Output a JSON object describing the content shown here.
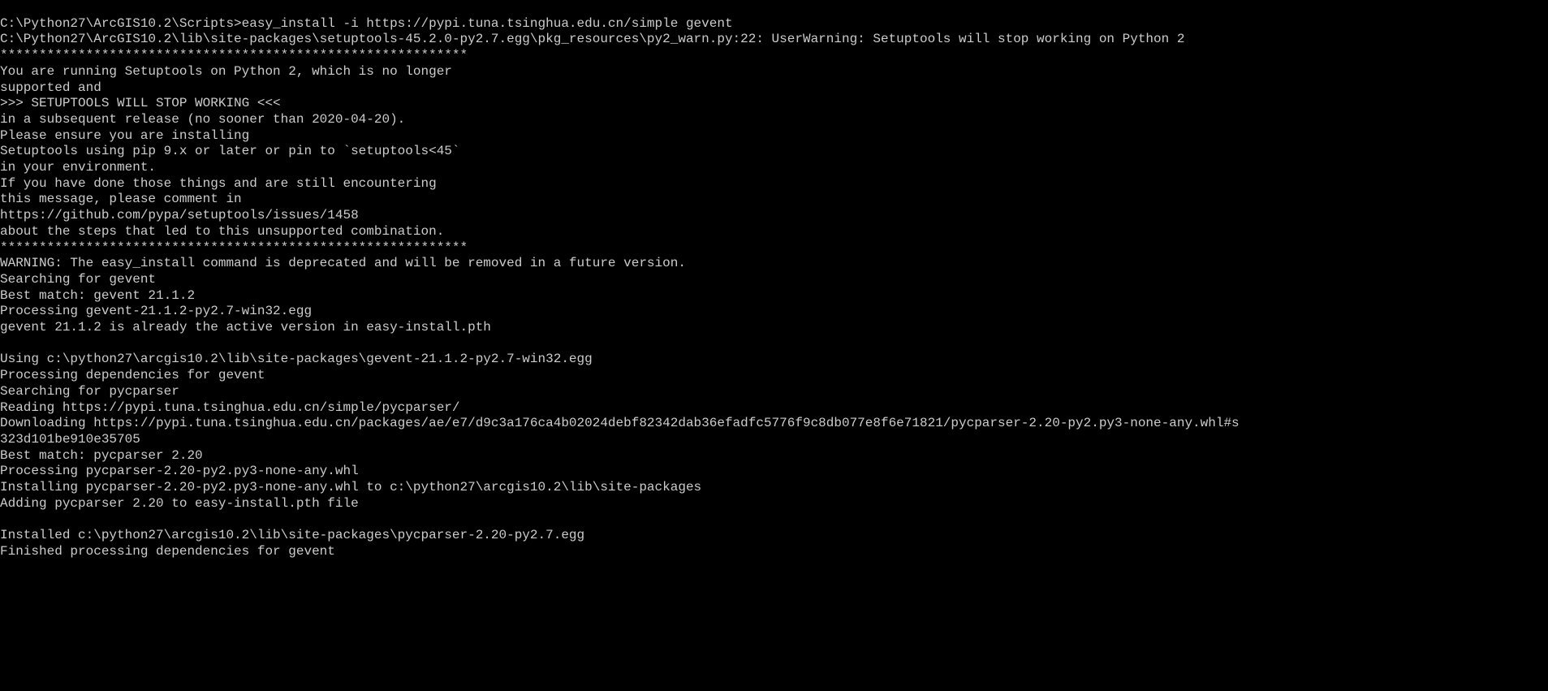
{
  "terminal": {
    "lines": [
      "",
      "C:\\Python27\\ArcGIS10.2\\Scripts>easy_install -i https://pypi.tuna.tsinghua.edu.cn/simple gevent",
      "C:\\Python27\\ArcGIS10.2\\lib\\site-packages\\setuptools-45.2.0-py2.7.egg\\pkg_resources\\py2_warn.py:22: UserWarning: Setuptools will stop working on Python 2",
      "************************************************************",
      "You are running Setuptools on Python 2, which is no longer",
      "supported and",
      ">>> SETUPTOOLS WILL STOP WORKING <<<",
      "in a subsequent release (no sooner than 2020-04-20).",
      "Please ensure you are installing",
      "Setuptools using pip 9.x or later or pin to `setuptools<45`",
      "in your environment.",
      "If you have done those things and are still encountering",
      "this message, please comment in",
      "https://github.com/pypa/setuptools/issues/1458",
      "about the steps that led to this unsupported combination.",
      "************************************************************",
      "WARNING: The easy_install command is deprecated and will be removed in a future version.",
      "Searching for gevent",
      "Best match: gevent 21.1.2",
      "Processing gevent-21.1.2-py2.7-win32.egg",
      "gevent 21.1.2 is already the active version in easy-install.pth",
      "",
      "Using c:\\python27\\arcgis10.2\\lib\\site-packages\\gevent-21.1.2-py2.7-win32.egg",
      "Processing dependencies for gevent",
      "Searching for pycparser",
      "Reading https://pypi.tuna.tsinghua.edu.cn/simple/pycparser/",
      "Downloading https://pypi.tuna.tsinghua.edu.cn/packages/ae/e7/d9c3a176ca4b02024debf82342dab36efadfc5776f9c8db077e8f6e71821/pycparser-2.20-py2.py3-none-any.whl#s",
      "323d101be910e35705",
      "Best match: pycparser 2.20",
      "Processing pycparser-2.20-py2.py3-none-any.whl",
      "Installing pycparser-2.20-py2.py3-none-any.whl to c:\\python27\\arcgis10.2\\lib\\site-packages",
      "Adding pycparser 2.20 to easy-install.pth file",
      "",
      "Installed c:\\python27\\arcgis10.2\\lib\\site-packages\\pycparser-2.20-py2.7.egg",
      "Finished processing dependencies for gevent"
    ]
  }
}
